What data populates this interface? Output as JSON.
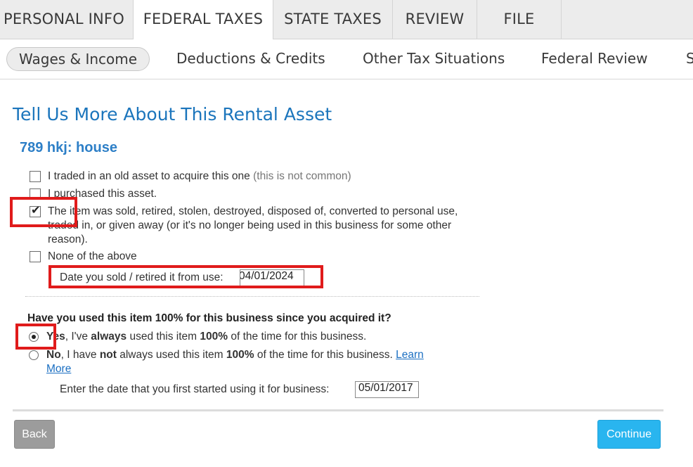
{
  "top_tabs": [
    {
      "label": "PERSONAL INFO"
    },
    {
      "label": "FEDERAL TAXES"
    },
    {
      "label": "STATE TAXES"
    },
    {
      "label": "REVIEW"
    },
    {
      "label": "FILE"
    }
  ],
  "sub_tabs": [
    {
      "label": "Wages & Income"
    },
    {
      "label": "Deductions & Credits"
    },
    {
      "label": "Other Tax Situations"
    },
    {
      "label": "Federal Review"
    },
    {
      "label": "S"
    }
  ],
  "page": {
    "title": "Tell Us More About This Rental Asset",
    "asset_name": "789 hkj: house"
  },
  "options": [
    {
      "text": "I traded in an old asset to acquire this one",
      "note": "(this is not common)",
      "checked": false
    },
    {
      "text": "I purchased this asset.",
      "checked": false
    },
    {
      "text": "The item was sold, retired, stolen, destroyed, disposed of, converted to personal use, traded in, or given away (or it's no longer being used in this business for some other reason).",
      "checked": true
    },
    {
      "text": "None of the above",
      "checked": false
    }
  ],
  "sold_date": {
    "label": "Date you sold / retired it from use:",
    "value": "04/01/2024",
    "visible_value": "04/01/2024"
  },
  "usage_question": {
    "question": "Have you used this item 100% for this business since you acquired it?",
    "yes": {
      "w1": "Yes",
      "w2": ", I've ",
      "w3": "always",
      "w4": " used this item ",
      "w5": "100%",
      "w6": " of the time for this business.",
      "selected": true
    },
    "no": {
      "w1": "No",
      "w2": ", I have ",
      "w3": "not",
      "w4": " always used this item ",
      "w5": "100%",
      "w6": " of the time for this business. ",
      "link1": "Learn",
      "link2": "More",
      "selected": false
    },
    "start_date_label": "Enter the date that you first started using it for business:",
    "start_date_value": "05/01/2017"
  },
  "buttons": {
    "back": "Back",
    "continue": "Continue"
  },
  "colors": {
    "title_blue": "#1b75bc",
    "continue_blue": "#29b5ef",
    "annotation_red": "#e01b1b"
  }
}
